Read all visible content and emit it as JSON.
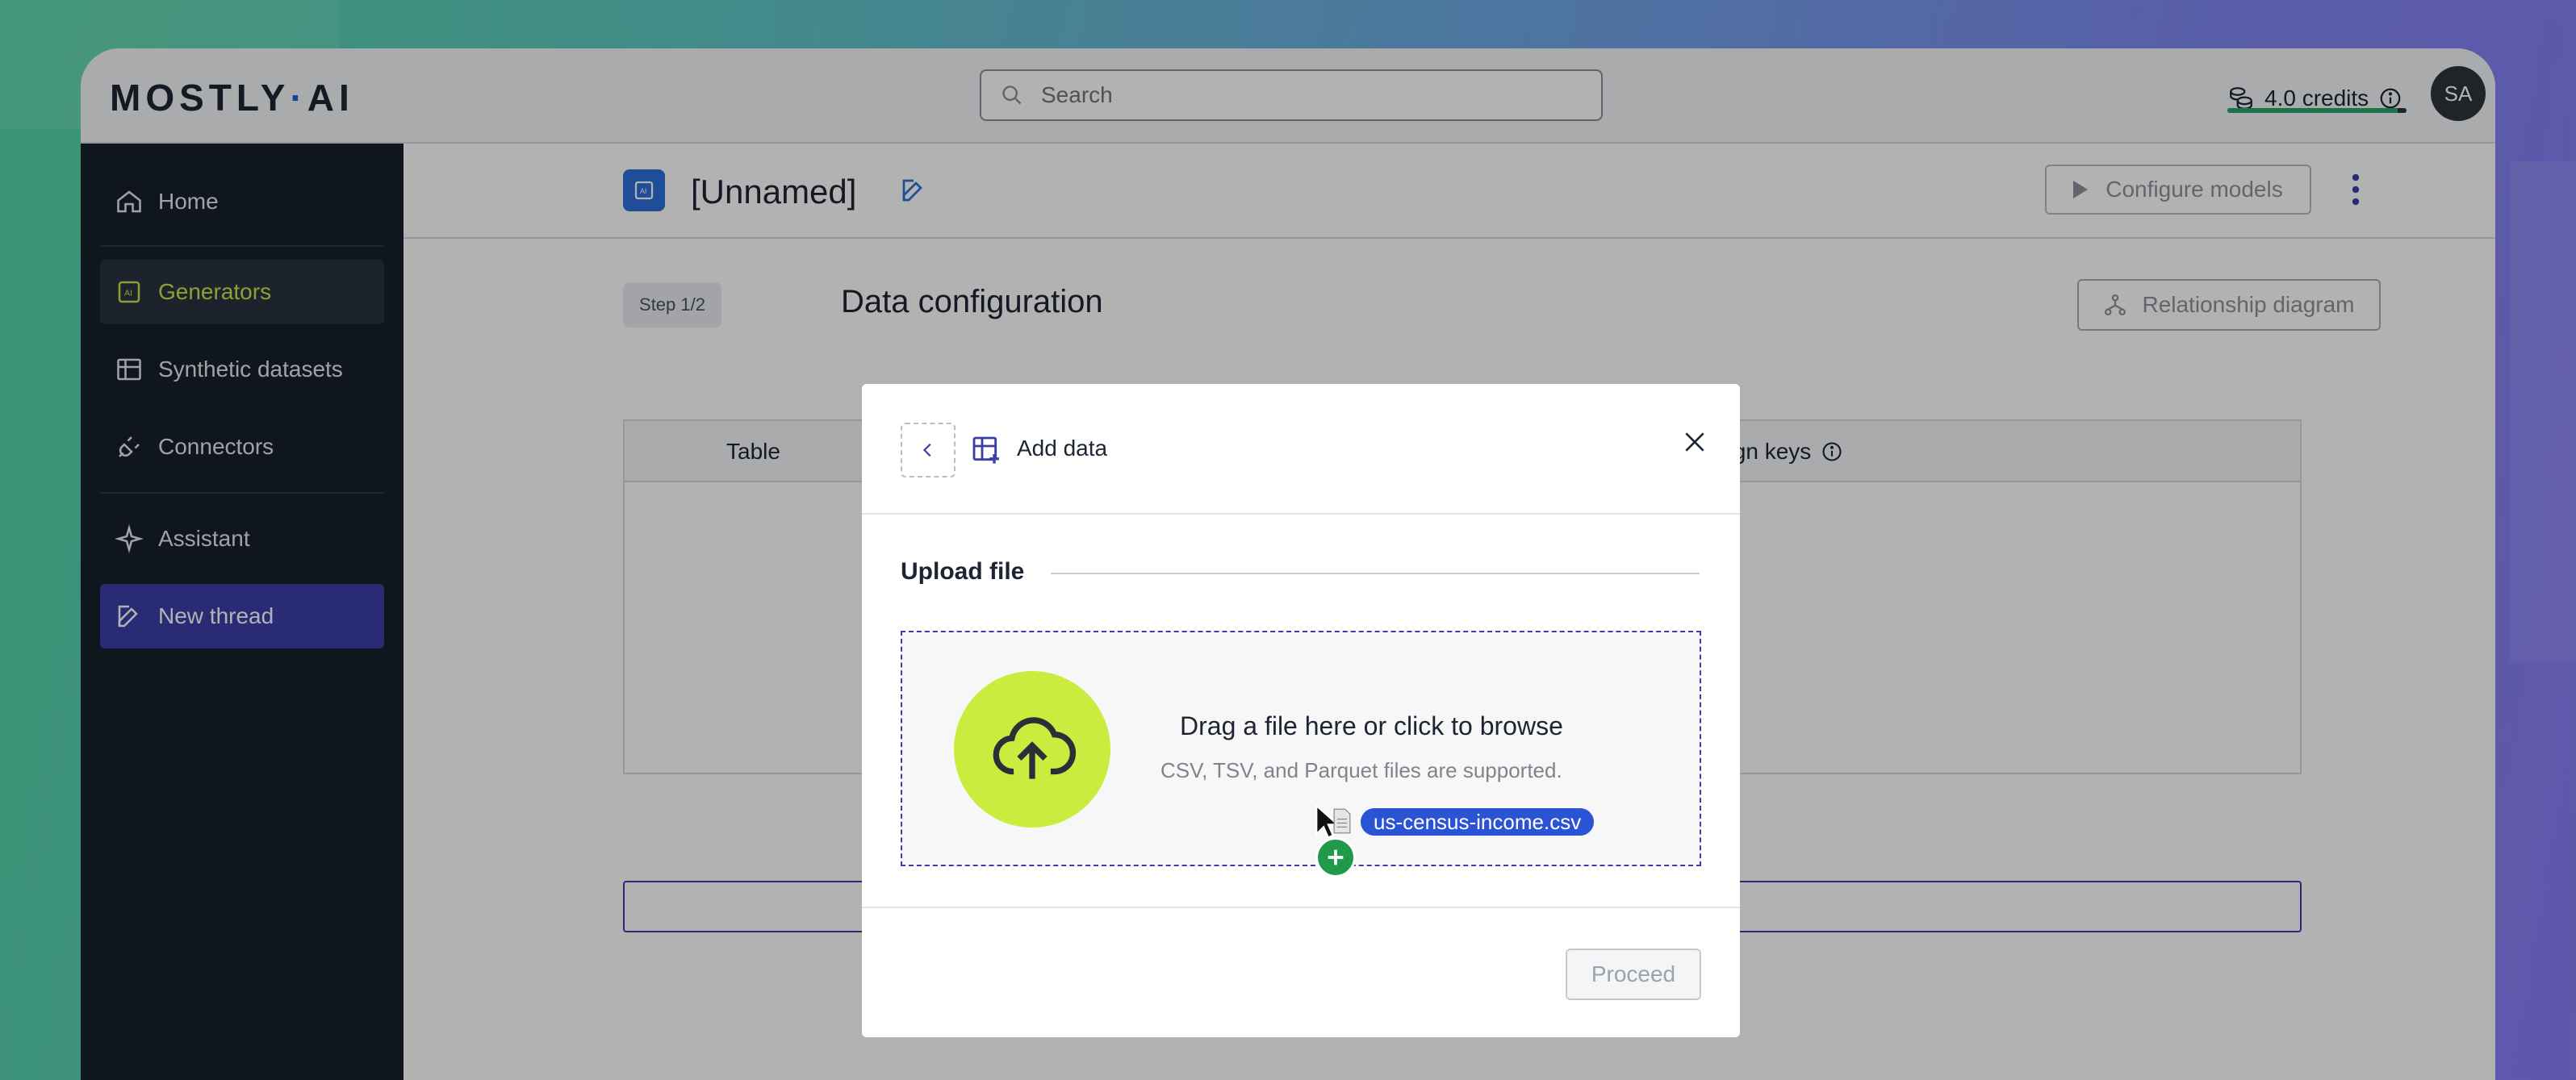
{
  "app": {
    "logo_text": "MOSTLY",
    "logo_dot": "·",
    "logo_suffix": "AI"
  },
  "header": {
    "search_placeholder": "Search",
    "credits_label": "4.0 credits",
    "credits_fraction": 0.95,
    "avatar_initials": "SA"
  },
  "sidebar": {
    "items": [
      {
        "label": "Home",
        "icon": "home-icon"
      },
      {
        "label": "Generators",
        "icon": "generator-icon",
        "active": true
      },
      {
        "label": "Synthetic datasets",
        "icon": "table-icon"
      },
      {
        "label": "Connectors",
        "icon": "plug-icon"
      },
      {
        "label": "Assistant",
        "icon": "sparkle-icon"
      },
      {
        "label": "New thread",
        "icon": "pencil-square-icon"
      }
    ]
  },
  "page": {
    "title": "[Unnamed]",
    "configure_label": "Configure models",
    "step_label": "Step 1/2",
    "section_title": "Data configuration",
    "relationship_label": "Relationship diagram",
    "table_col_table": "Table",
    "table_col_fk": "eign keys"
  },
  "modal": {
    "title": "Add data",
    "upload_label": "Upload file",
    "drop_main": "Drag a file here or click to browse",
    "drop_sub": "CSV, TSV, and Parquet files are supported.",
    "dragged_file": "us-census-income.csv",
    "proceed_label": "Proceed"
  },
  "colors": {
    "accent": "#3b3fa7",
    "active_nav_text": "#c6e84a",
    "upload_circle": "#c9ec3f",
    "sidebar_bg": "#17202b"
  }
}
